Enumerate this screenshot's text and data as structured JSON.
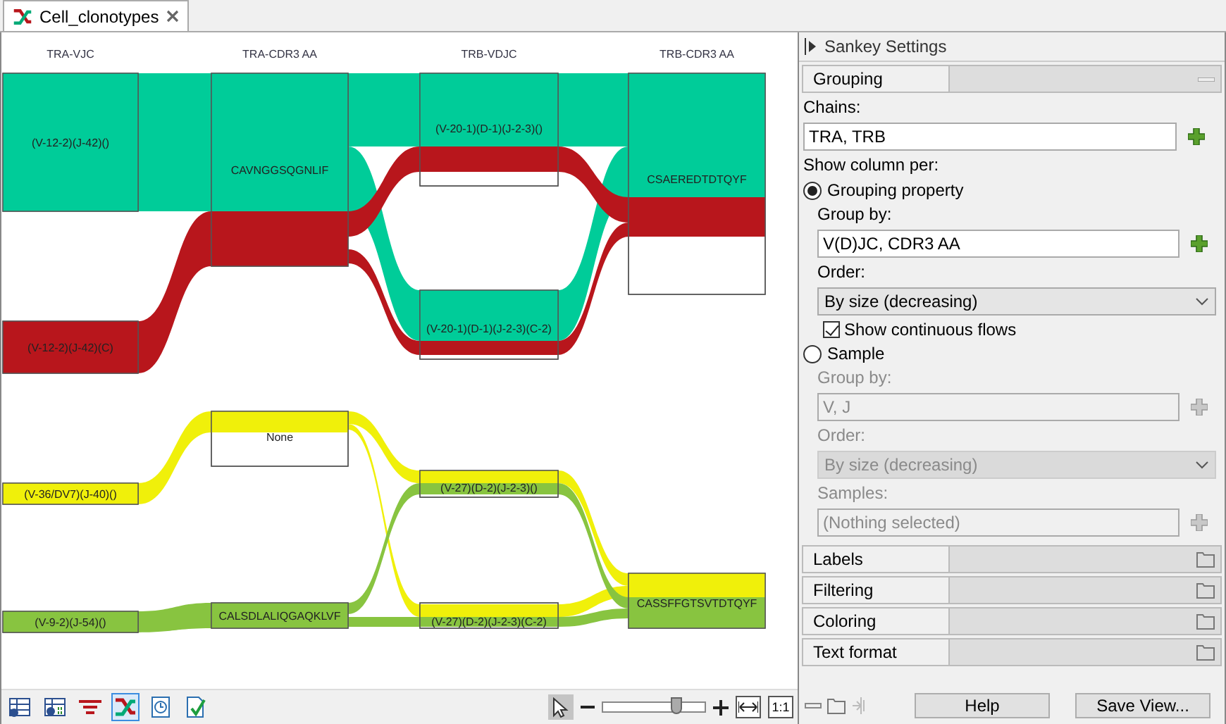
{
  "tab": {
    "title": "Cell_clonotypes"
  },
  "chart": {
    "columns": [
      {
        "header": "TRA-VJC",
        "nodes": [
          {
            "label": "(V-12-2)(J-42)()"
          },
          {
            "label": "(V-12-2)(J-42)(C)"
          },
          {
            "label": "(V-36/DV7)(J-40)()"
          },
          {
            "label": "(V-9-2)(J-54)()"
          }
        ]
      },
      {
        "header": "TRA-CDR3 AA",
        "nodes": [
          {
            "label": "CAVNGGSQGNLIF"
          },
          {
            "label": "None"
          },
          {
            "label": "CALSDLALIQGAQKLVF"
          }
        ]
      },
      {
        "header": "TRB-VDJC",
        "nodes": [
          {
            "label": "(V-20-1)(D-1)(J-2-3)()"
          },
          {
            "label": "(V-20-1)(D-1)(J-2-3)(C-2)"
          },
          {
            "label": "(V-27)(D-2)(J-2-3)()"
          },
          {
            "label": "(V-27)(D-2)(J-2-3)(C-2)"
          }
        ]
      },
      {
        "header": "TRB-CDR3 AA",
        "nodes": [
          {
            "label": "CSAEREDTDTQYF"
          },
          {
            "label": "CASSFFGTSVTDTQYF"
          }
        ]
      }
    ]
  },
  "view_tools": [
    {
      "selected": false
    },
    {
      "selected": false
    },
    {
      "selected": false
    },
    {
      "selected": true
    },
    {
      "selected": false
    },
    {
      "selected": false
    }
  ],
  "zoom": {
    "pointer_selected": true,
    "level": 0.72,
    "actual_size_label": "1:1"
  },
  "settings": {
    "title": "Sankey Settings",
    "grouping": {
      "title": "Grouping",
      "expanded": true,
      "chains_label": "Chains:",
      "chains_value": "TRA, TRB",
      "show_column_label": "Show column per:",
      "options": [
        {
          "label": "Grouping property",
          "selected": true,
          "disabled": false,
          "group_by_label": "Group by:",
          "group_by_value": "V(D)JC, CDR3 AA",
          "order_label": "Order:",
          "order_value": "By size (decreasing)",
          "continuous_label": "Show continuous flows",
          "continuous_checked": true
        },
        {
          "label": "Sample",
          "selected": false,
          "disabled": true,
          "group_by_label": "Group by:",
          "group_by_value": "V, J",
          "order_label": "Order:",
          "order_value": "By size (decreasing)",
          "samples_label": "Samples:",
          "samples_value": "(Nothing selected)"
        }
      ]
    },
    "sections": [
      {
        "title": "Labels",
        "expanded": false
      },
      {
        "title": "Filtering",
        "expanded": false
      },
      {
        "title": "Coloring",
        "expanded": false
      },
      {
        "title": "Text format",
        "expanded": false
      }
    ],
    "buttons": [
      "Help",
      "Save View..."
    ]
  }
}
